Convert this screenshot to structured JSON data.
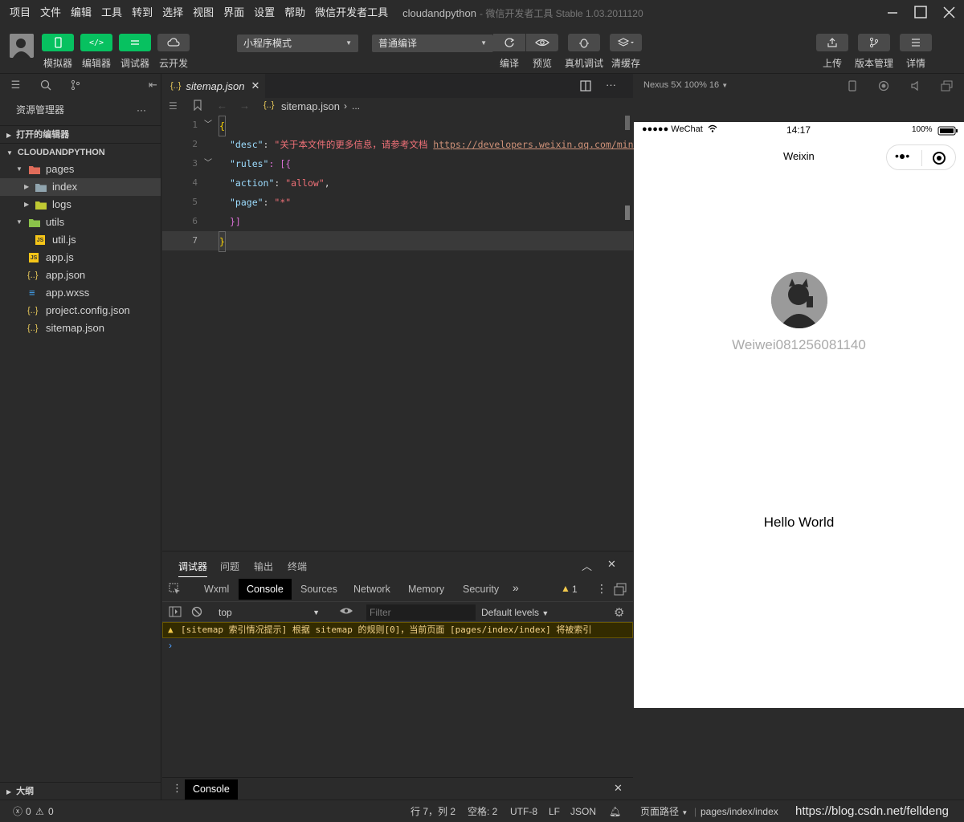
{
  "menu": [
    "项目",
    "文件",
    "编辑",
    "工具",
    "转到",
    "选择",
    "视图",
    "界面",
    "设置",
    "帮助",
    "微信开发者工具"
  ],
  "app": {
    "project": "cloudandpython",
    "title_suffix": "- 微信开发者工具 Stable 1.03.2011120"
  },
  "toolbar": {
    "simulator": "模拟器",
    "editor": "编辑器",
    "debugger": "调试器",
    "cloud": "云开发",
    "mode_select": "小程序模式",
    "compile_select": "普通编译",
    "compile": "编译",
    "preview": "预览",
    "real_debug": "真机调试",
    "clear_cache": "清缓存",
    "upload": "上传",
    "version": "版本管理",
    "details": "详情"
  },
  "sidebar": {
    "explorer_title": "资源管理器",
    "more": "···",
    "open_editors": "打开的编辑器",
    "project": "CLOUDANDPYTHON",
    "tree": [
      {
        "label": "pages"
      },
      {
        "label": "index"
      },
      {
        "label": "logs"
      },
      {
        "label": "utils"
      },
      {
        "label": "util.js"
      },
      {
        "label": "app.js"
      },
      {
        "label": "app.json"
      },
      {
        "label": "app.wxss"
      },
      {
        "label": "project.config.json"
      },
      {
        "label": "sitemap.json"
      }
    ],
    "outline": "大纲"
  },
  "editor": {
    "tab_label": "sitemap.json",
    "tab_icon": "{..}",
    "breadcrumb_file": "sitemap.json",
    "breadcrumb_more": "...",
    "line_numbers": [
      "1",
      "2",
      "3",
      "4",
      "5",
      "6",
      "7"
    ],
    "code": {
      "l1": "{",
      "l2_key": "\"desc\"",
      "l2_val": "\"关于本文件的更多信息，请参考文档 ",
      "l2_url": "https://developers.weixin.qq.com/mini",
      "l3_key": "\"rules\"",
      "l3_rest": ": [{",
      "l4_key": "\"action\"",
      "l4_val": "\"allow\"",
      "l5_key": "\"page\"",
      "l5_val": "\"*\"",
      "l6": "}]",
      "l7": "}"
    }
  },
  "debug": {
    "tabs": [
      "调试器",
      "问题",
      "输出",
      "终端"
    ],
    "devtools_tabs": [
      "Wxml",
      "Console",
      "Sources",
      "Network",
      "Memory",
      "Security"
    ],
    "warn_count": "1",
    "context": "top",
    "filter_placeholder": "Filter",
    "levels": "Default levels",
    "warning": "[sitemap 索引情况提示] 根据 sitemap 的规则[0]，当前页面 [pages/index/index] 将被索引",
    "prompt": "›",
    "drawer_tab": "Console"
  },
  "simulator": {
    "device": "Nexus 5X 100% 16",
    "signal": "●●●●● WeChat",
    "time": "14:17",
    "battery": "100%",
    "nav_title": "Weixin",
    "username": "Weiwei081256081140",
    "hello": "Hello World"
  },
  "status": {
    "errors": "0",
    "warnings": "0",
    "position": "行 7，列 2",
    "spaces": "空格: 2",
    "encoding": "UTF-8",
    "eol": "LF",
    "language": "JSON",
    "page_path_label": "页面路径",
    "page_path": "pages/index/index",
    "watermark": "https://blog.csdn.net/felldeng"
  },
  "colors": {
    "accent": "#07c160",
    "warn_bg": "#332b00",
    "warn_text": "#f2d28a"
  }
}
